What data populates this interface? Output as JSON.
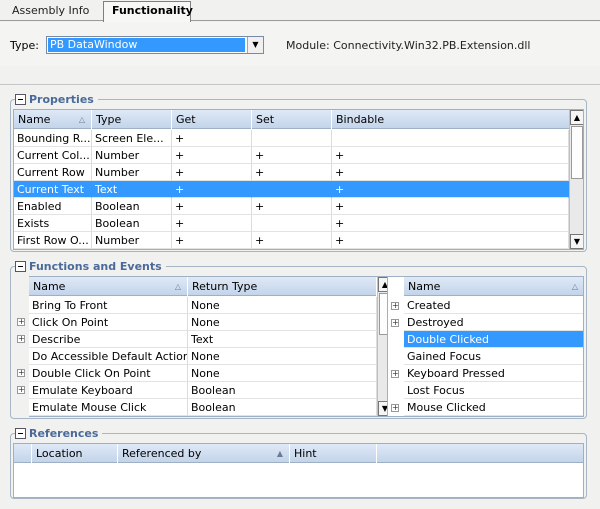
{
  "tabs": [
    {
      "label": "Assembly Info"
    },
    {
      "label": "Functionality"
    }
  ],
  "header": {
    "type_label": "Type:",
    "type_value": "PB DataWindow",
    "module_text": "Module:  Connectivity.Win32.PB.Extension.dll"
  },
  "properties": {
    "title": "Properties",
    "columns": [
      "Name",
      "Type",
      "Get",
      "Set",
      "Bindable"
    ],
    "rows": [
      {
        "name": "Bounding R...",
        "type": "Screen Ele...",
        "get": "+",
        "set": "",
        "bindable": ""
      },
      {
        "name": "Current Col...",
        "type": "Number",
        "get": "+",
        "set": "+",
        "bindable": "+"
      },
      {
        "name": "Current Row",
        "type": "Number",
        "get": "+",
        "set": "+",
        "bindable": "+"
      },
      {
        "name": "Current Text",
        "type": "Text",
        "get": "+",
        "set": "",
        "bindable": "+"
      },
      {
        "name": "Enabled",
        "type": "Boolean",
        "get": "+",
        "set": "+",
        "bindable": "+"
      },
      {
        "name": "Exists",
        "type": "Boolean",
        "get": "+",
        "set": "",
        "bindable": "+"
      },
      {
        "name": "First Row O...",
        "type": "Number",
        "get": "+",
        "set": "+",
        "bindable": "+"
      }
    ],
    "selected_index": 3
  },
  "functions": {
    "title": "Functions and Events",
    "columns": [
      "Name",
      "Return Type"
    ],
    "rows": [
      {
        "name": "Bring To Front",
        "ret": "None",
        "expandable": false
      },
      {
        "name": "Click On Point",
        "ret": "None",
        "expandable": true
      },
      {
        "name": "Describe",
        "ret": "Text",
        "expandable": true
      },
      {
        "name": "Do Accessible Default Action",
        "ret": "None",
        "expandable": false
      },
      {
        "name": "Double Click On Point",
        "ret": "None",
        "expandable": true
      },
      {
        "name": "Emulate Keyboard",
        "ret": "Boolean",
        "expandable": true
      },
      {
        "name": "Emulate Mouse Click",
        "ret": "Boolean",
        "expandable": false
      }
    ]
  },
  "events": {
    "columns": [
      "Name"
    ],
    "rows": [
      {
        "name": "Created",
        "expandable": true
      },
      {
        "name": "Destroyed",
        "expandable": true
      },
      {
        "name": "Double Clicked",
        "expandable": false
      },
      {
        "name": "Gained Focus",
        "expandable": false
      },
      {
        "name": "Keyboard Pressed",
        "expandable": true
      },
      {
        "name": "Lost Focus",
        "expandable": false
      },
      {
        "name": "Mouse Clicked",
        "expandable": true
      }
    ],
    "selected_index": 2
  },
  "references": {
    "title": "References",
    "columns": [
      "Location",
      "Referenced by",
      "Hint"
    ]
  },
  "icons": {
    "expand": "expand-plus-icon",
    "dropdown": "chevron-down-icon",
    "sort": "sort-arrow-icon",
    "scroll_up": "scroll-up-icon",
    "scroll_down": "scroll-down-icon"
  },
  "colors": {
    "selection": "#3399ff",
    "group_title": "#4a6a9a",
    "header_gradient_top": "#dfe9f6",
    "header_gradient_bottom": "#c3d4ea"
  }
}
